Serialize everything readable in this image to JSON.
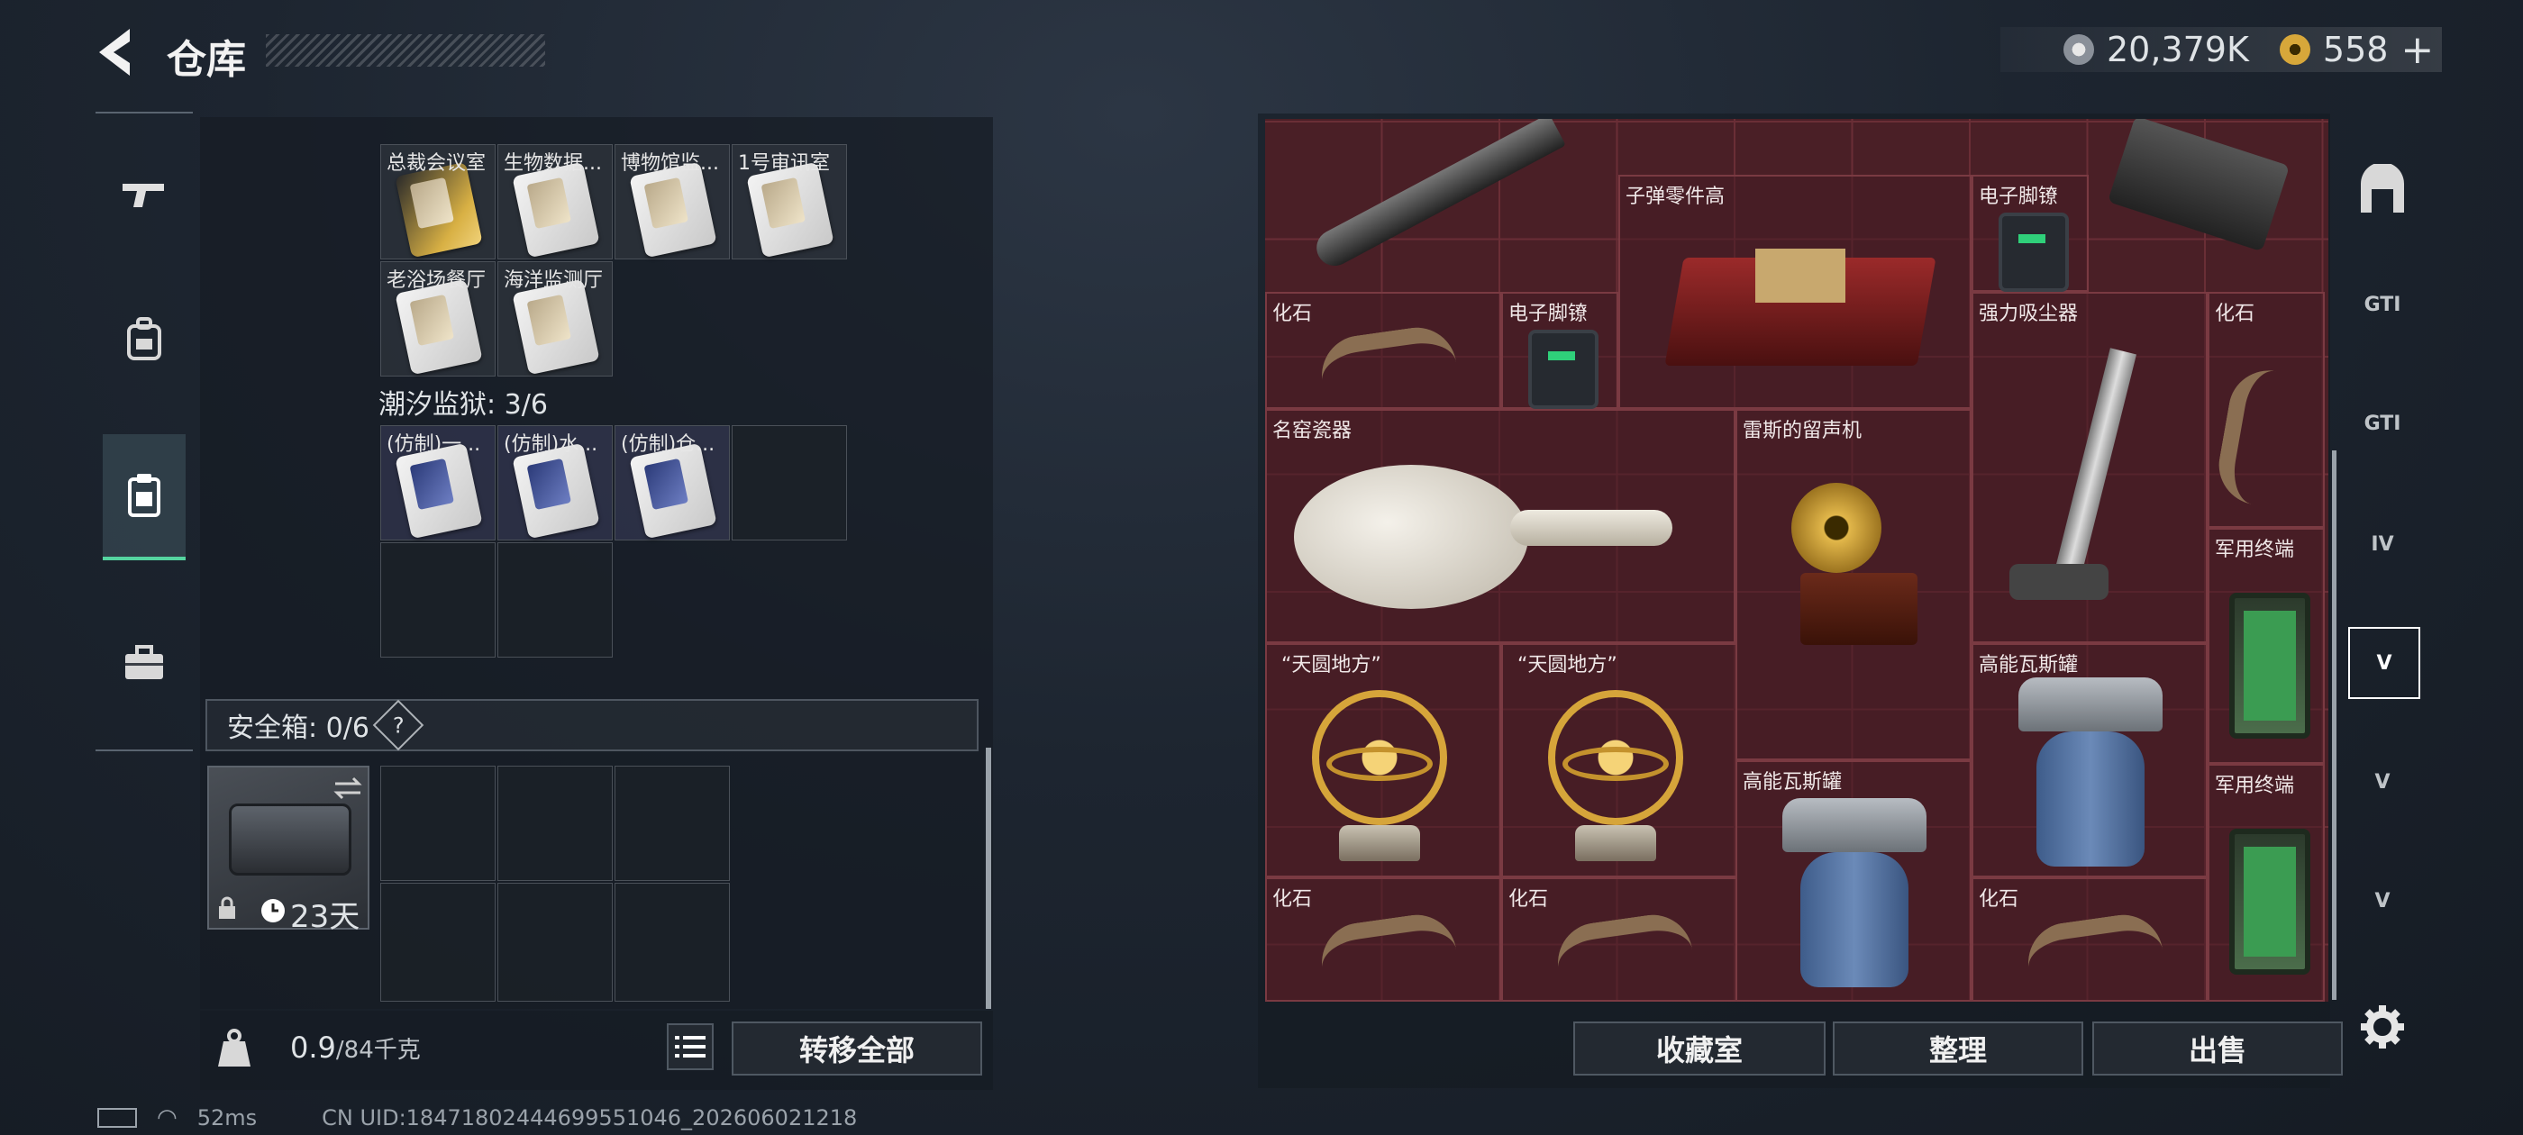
{
  "header": {
    "title": "仓库",
    "currency_primary": "20,379K",
    "currency_secondary": "558",
    "add_symbol": "+"
  },
  "left_nav": {
    "items": [
      {
        "icon": "gun-icon"
      },
      {
        "icon": "backpack-icon"
      },
      {
        "icon": "clipboard-icon",
        "active": true
      },
      {
        "icon": "briefcase-icon"
      }
    ]
  },
  "keycards": {
    "row1": [
      "总裁会议室",
      "生物数据...",
      "博物馆监...",
      "1号审讯室"
    ],
    "row2": [
      "老浴场餐厅",
      "海洋监测厅"
    ],
    "prison_label": "潮汐监狱: 3/6",
    "prison_cards": [
      "(仿制)一...",
      "(仿制)水...",
      "(仿制)仓..."
    ]
  },
  "safe_box": {
    "label": "安全箱: 0/6",
    "help": "?",
    "timer": "23天"
  },
  "footer_left": {
    "weight_current": "0.9",
    "weight_max": "/84千克",
    "transfer_all": "转移全部"
  },
  "stash": {
    "items": [
      {
        "label": "子弹零件高"
      },
      {
        "label": "电子脚镣"
      },
      {
        "label": "化石"
      },
      {
        "label": "电子脚镣"
      },
      {
        "label": "强力吸尘器"
      },
      {
        "label": "化石"
      },
      {
        "label": "名窑瓷器"
      },
      {
        "label": "雷斯的留声机"
      },
      {
        "label": "军用终端"
      },
      {
        "label": "“天圆地方”"
      },
      {
        "label": "“天圆地方”"
      },
      {
        "label": "高能瓦斯罐"
      },
      {
        "label": "高能瓦斯罐"
      },
      {
        "label": "军用终端"
      },
      {
        "label": "化石"
      },
      {
        "label": "化石"
      },
      {
        "label": "化石"
      }
    ]
  },
  "footer_right": {
    "collection": "收藏室",
    "organize": "整理",
    "sell": "出售"
  },
  "right_nav": {
    "tabs": [
      "GTI",
      "GTI",
      "IV",
      "V",
      "V",
      "V"
    ]
  },
  "status": {
    "ping": "52ms",
    "uid": "CN UID:18471802444699551046_202606021218"
  },
  "colors": {
    "accent_green": "#55d4a0",
    "stash_bg": "#4a1f26"
  }
}
